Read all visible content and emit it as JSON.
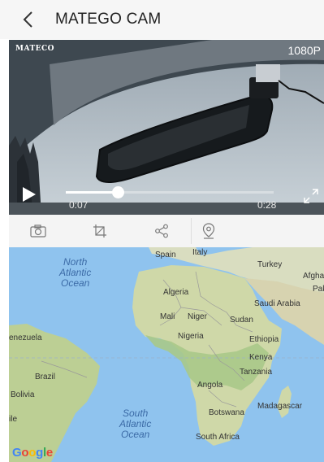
{
  "header": {
    "title": "MATEGO CAM"
  },
  "video": {
    "camera_logo": "MATECO",
    "resolution": "1080P",
    "current_time": "0:07",
    "total_time": "0:28",
    "progress": 0.25
  },
  "toolbar": {
    "items": [
      "camera-icon",
      "crop-icon",
      "share-icon",
      "location-pin-icon"
    ]
  },
  "map": {
    "oceans": {
      "north_atlantic": [
        "North",
        "Atlantic",
        "Ocean"
      ],
      "south_atlantic": [
        "South",
        "Atlantic",
        "Ocean"
      ]
    },
    "labels": {
      "spain": "Spain",
      "italy": "Italy",
      "turkey": "Turkey",
      "afghanistan": "Afgha",
      "pakistan": "Pak",
      "algeria": "Algeria",
      "saudi_arabia": "Saudi Arabia",
      "mali": "Mali",
      "niger": "Niger",
      "sudan": "Sudan",
      "nigeria": "Nigeria",
      "ethiopia": "Ethiopia",
      "venezuela": "enezuela",
      "kenya": "Kenya",
      "tanzania": "Tanzania",
      "brazil": "Brazil",
      "angola": "Angola",
      "bolivia": "Bolivia",
      "madagascar": "Madagascar",
      "botswana": "Botswana",
      "chile": "ile",
      "south_africa": "South Africa"
    },
    "attribution": "Google"
  }
}
